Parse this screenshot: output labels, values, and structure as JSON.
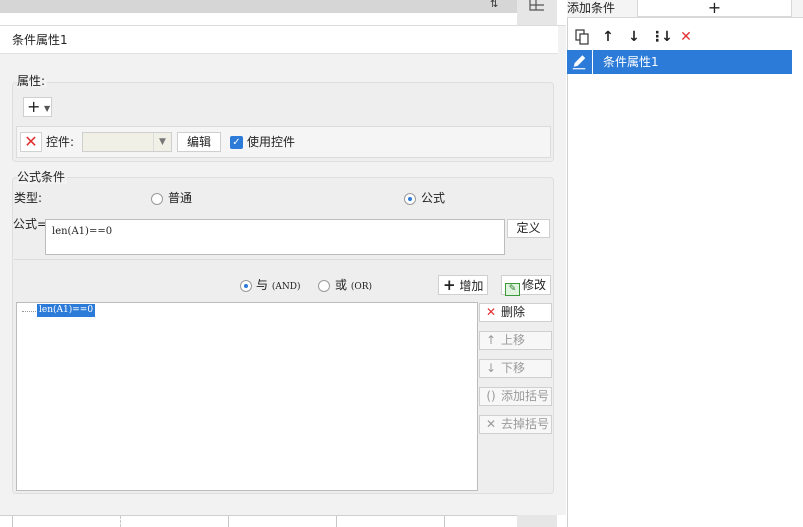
{
  "condition_title": "条件属性1",
  "attributes": {
    "group_label": "属性:",
    "add_button": "+",
    "control_label": "控件:",
    "control_value": "",
    "edit_button": "编辑",
    "use_control_label": "使用控件",
    "use_control_checked": true
  },
  "formula_condition": {
    "group_label": "公式条件",
    "type_label": "类型:",
    "type_options": [
      "普通",
      "公式"
    ],
    "type_selected": "公式",
    "formula_label": "公式=",
    "formula_value": "len(A1)==0",
    "define_button": "定义",
    "logic_options": [
      {
        "label": "与",
        "latin": "(AND)",
        "selected": true
      },
      {
        "label": "或",
        "latin": "(OR)",
        "selected": false
      }
    ],
    "add_button": "增加",
    "modify_button": "修改",
    "tree_items": [
      "len(A1)==0"
    ],
    "side_buttons": {
      "delete": "删除",
      "move_up": "上移",
      "move_down": "下移",
      "add_paren": "添加括号",
      "remove_paren": "去掉括号"
    }
  },
  "right_panel": {
    "add_condition_label": "添加条件",
    "add_condition_button": "+",
    "toolbar_icons": [
      "copy-icon",
      "arrow-up-icon",
      "arrow-down-icon",
      "sort-down-icon",
      "delete-icon"
    ],
    "list_items": [
      "条件属性1"
    ],
    "selected_index": 0
  },
  "colors": {
    "accent": "#2d7bd8",
    "danger": "#e03030",
    "panel_bg": "#f2f2f2"
  }
}
